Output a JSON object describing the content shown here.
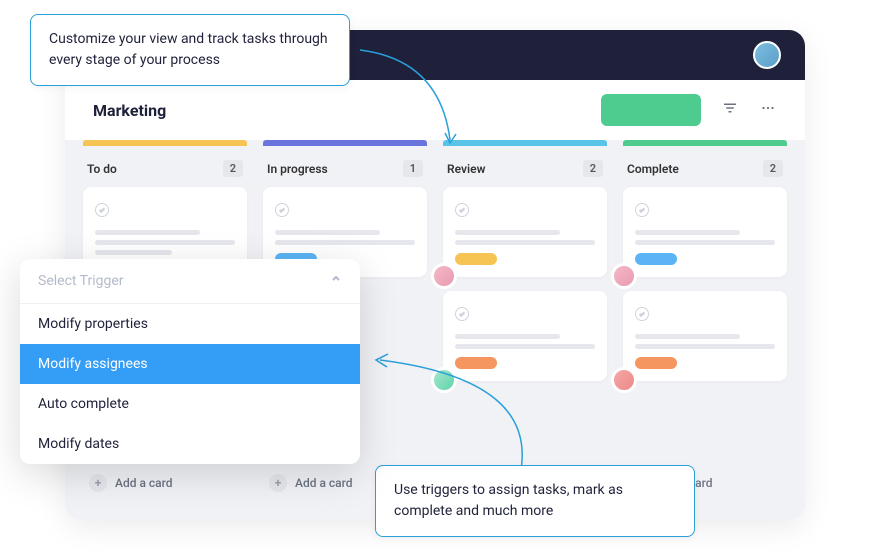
{
  "callouts": {
    "top": "Customize your view and track tasks through every stage of your process",
    "bottom": "Use triggers to assign tasks, mark as complete and much more"
  },
  "header": {
    "title": "Marketing"
  },
  "columns": [
    {
      "title": "To do",
      "count": "2"
    },
    {
      "title": "In progress",
      "count": "1"
    },
    {
      "title": "Review",
      "count": "2"
    },
    {
      "title": "Complete",
      "count": "2"
    }
  ],
  "add_card_label": "Add a card",
  "dropdown": {
    "label": "Select Trigger",
    "items": [
      "Modify properties",
      "Modify assignees",
      "Auto complete",
      "Modify dates"
    ]
  }
}
